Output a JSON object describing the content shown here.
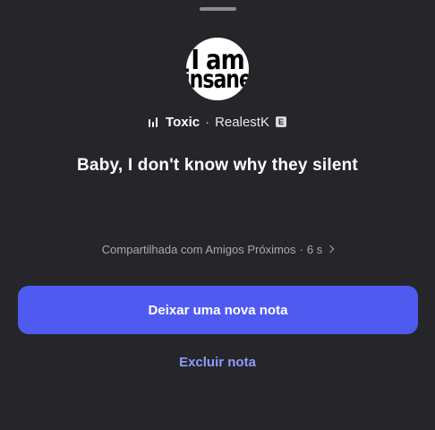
{
  "avatar": {
    "line1": "I am",
    "line2": "insane"
  },
  "track": {
    "title": "Toxic",
    "separator": "·",
    "artist": "RealestK",
    "explicit_badge": "E",
    "icon": "music-bars-icon"
  },
  "note": {
    "text": "Baby, I don't know why they silent"
  },
  "status": {
    "shared_with": "Compartilhada com Amigos Próximos",
    "separator": "·",
    "time_ago": "6 s",
    "icon": "chevron-right-icon"
  },
  "actions": {
    "new_note_label": "Deixar uma nova nota",
    "delete_note_label": "Excluir nota"
  },
  "colors": {
    "background": "#26262a",
    "primary_button": "#4f5bf0",
    "link": "#8f9bff",
    "muted_text": "#a9a9ae"
  }
}
